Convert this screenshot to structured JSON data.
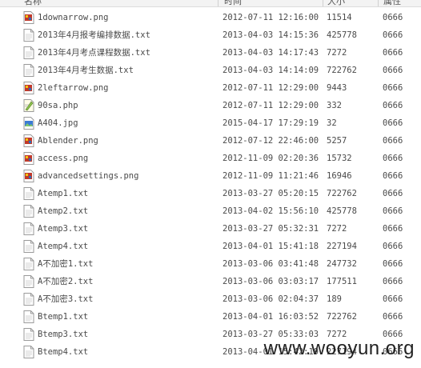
{
  "columns": {
    "name": "名称",
    "time": "时间",
    "size": "大小",
    "perm": "属性"
  },
  "files": [
    {
      "name": "1downarrow.png",
      "time": "2012-07-11 12:16:00",
      "size": "11514",
      "perm": "0666",
      "icon": "image-file-icon"
    },
    {
      "name": "2013年4月报考编排数据.txt",
      "time": "2013-04-03 14:15:36",
      "size": "425778",
      "perm": "0666",
      "icon": "text-file-icon"
    },
    {
      "name": "2013年4月考点课程数据.txt",
      "time": "2013-04-03 14:17:43",
      "size": "7272",
      "perm": "0666",
      "icon": "text-file-icon"
    },
    {
      "name": "2013年4月考生数据.txt",
      "time": "2013-04-03 14:14:09",
      "size": "722762",
      "perm": "0666",
      "icon": "text-file-icon"
    },
    {
      "name": "2leftarrow.png",
      "time": "2012-07-11 12:29:00",
      "size": "9443",
      "perm": "0666",
      "icon": "image-file-icon"
    },
    {
      "name": "90sa.php",
      "time": "2012-07-11 12:29:00",
      "size": "332",
      "perm": "0666",
      "icon": "script-file-icon"
    },
    {
      "name": "A404.jpg",
      "time": "2015-04-17 17:29:19",
      "size": "32",
      "perm": "0666",
      "icon": "jpg-file-icon"
    },
    {
      "name": "Ablender.png",
      "time": "2012-07-12 22:46:00",
      "size": "5257",
      "perm": "0666",
      "icon": "image-file-icon"
    },
    {
      "name": "access.png",
      "time": "2012-11-09 02:20:36",
      "size": "15732",
      "perm": "0666",
      "icon": "image-file-icon"
    },
    {
      "name": "advancedsettings.png",
      "time": "2012-11-09 11:21:46",
      "size": "16946",
      "perm": "0666",
      "icon": "image-file-icon"
    },
    {
      "name": "Atemp1.txt",
      "time": "2013-03-27 05:20:15",
      "size": "722762",
      "perm": "0666",
      "icon": "text-file-icon"
    },
    {
      "name": "Atemp2.txt",
      "time": "2013-04-02 15:56:10",
      "size": "425778",
      "perm": "0666",
      "icon": "text-file-icon"
    },
    {
      "name": "Atemp3.txt",
      "time": "2013-03-27 05:32:31",
      "size": "7272",
      "perm": "0666",
      "icon": "text-file-icon"
    },
    {
      "name": "Atemp4.txt",
      "time": "2013-04-01 15:41:18",
      "size": "227194",
      "perm": "0666",
      "icon": "text-file-icon"
    },
    {
      "name": "A不加密1.txt",
      "time": "2013-03-06 03:41:48",
      "size": "247732",
      "perm": "0666",
      "icon": "text-file-icon"
    },
    {
      "name": "A不加密2.txt",
      "time": "2013-03-06 03:03:17",
      "size": "177511",
      "perm": "0666",
      "icon": "text-file-icon"
    },
    {
      "name": "A不加密3.txt",
      "time": "2013-03-06 02:04:37",
      "size": "189",
      "perm": "0666",
      "icon": "text-file-icon"
    },
    {
      "name": "Btemp1.txt",
      "time": "2013-04-01 16:03:52",
      "size": "722762",
      "perm": "0666",
      "icon": "text-file-icon"
    },
    {
      "name": "Btemp3.txt",
      "time": "2013-03-27 05:33:03",
      "size": "7272",
      "perm": "0666",
      "icon": "text-file-icon"
    },
    {
      "name": "Btemp4.txt",
      "time": "2013-04-01 15:42:19",
      "size": "227194",
      "perm": "0666",
      "icon": "text-file-icon"
    }
  ],
  "watermark": "www.wooyun.org",
  "colors": {
    "header_bg": "#f3f3f3",
    "text": "#4a4a4a",
    "image_icon": "#c0392b",
    "jpg_icon": "#3a7bd5"
  }
}
